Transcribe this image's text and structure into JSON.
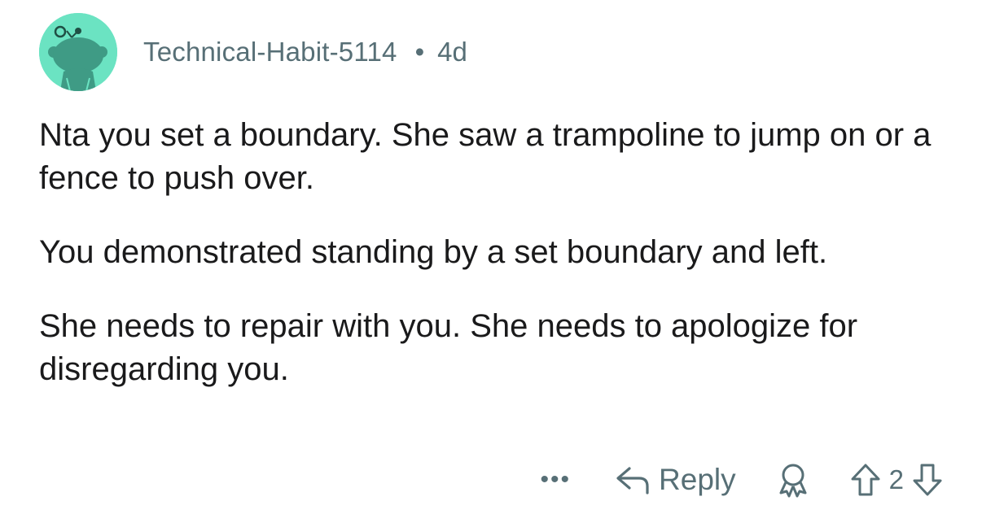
{
  "comment": {
    "username": "Technical-Habit-5114",
    "separator": "•",
    "age": "4d",
    "paragraphs": [
      "Nta you set a boundary. She saw a trampoline to jump on or a fence to push over.",
      "You demonstrated standing by a set boundary and left.",
      "She needs to repair with you. She needs to apologize for disregarding you."
    ],
    "actions": {
      "more_label": "•••",
      "reply_label": "Reply",
      "vote_count": "2"
    },
    "icons": {
      "avatar": "snoo-avatar-icon",
      "reply": "reply-arrow-icon",
      "award": "award-icon",
      "upvote": "upvote-arrow-icon",
      "downvote": "downvote-arrow-icon"
    },
    "colors": {
      "avatar_bg": "#6be3c2",
      "meta_text": "#576f76",
      "body_text": "#1a1a1b"
    }
  }
}
